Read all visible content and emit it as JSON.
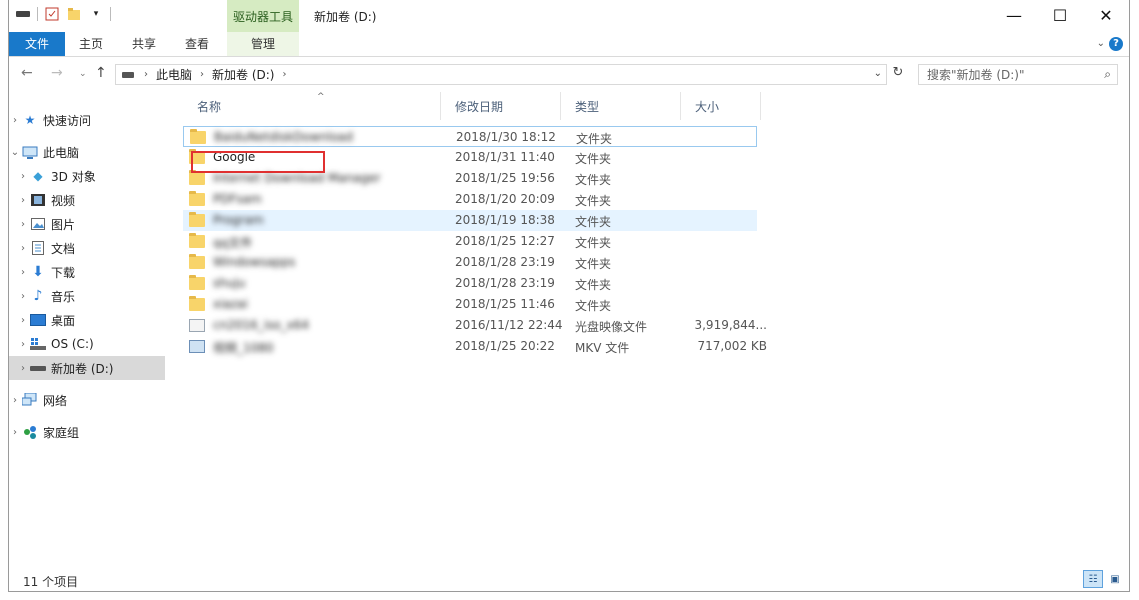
{
  "titlebar": {
    "context_tab_title": "驱动器工具",
    "window_title": "新加卷 (D:)",
    "minimize": "—",
    "maximize": "☐",
    "close": "✕"
  },
  "ribbon": {
    "tabs": {
      "file": "文件",
      "home": "主页",
      "share": "共享",
      "view": "查看",
      "manage": "管理"
    },
    "help": "?"
  },
  "address": {
    "crumbs": [
      "此电脑",
      "新加卷 (D:)"
    ],
    "separator": "›",
    "search_placeholder": "搜索\"新加卷 (D:)\""
  },
  "navpane": {
    "quick_access": "快速访问",
    "this_pc": "此电脑",
    "objects3d": "3D 对象",
    "videos": "视频",
    "pictures": "图片",
    "documents": "文档",
    "downloads": "下载",
    "music": "音乐",
    "desktop": "桌面",
    "os_c": "OS (C:)",
    "new_volume_d": "新加卷 (D:)",
    "network": "网络",
    "homegroup": "家庭组"
  },
  "columns": {
    "name": "名称",
    "date": "修改日期",
    "type": "类型",
    "size": "大小"
  },
  "files": [
    {
      "name": "BaiduNetdiskDownload",
      "date": "2018/1/30 18:12",
      "type": "文件夹",
      "size": "",
      "icon": "folder",
      "blurred": true
    },
    {
      "name": "Google",
      "date": "2018/1/31 11:40",
      "type": "文件夹",
      "size": "",
      "icon": "folder",
      "blurred": false
    },
    {
      "name": "Internet Download Manager",
      "date": "2018/1/25 19:56",
      "type": "文件夹",
      "size": "",
      "icon": "folder",
      "blurred": true
    },
    {
      "name": "PDFsam",
      "date": "2018/1/20 20:09",
      "type": "文件夹",
      "size": "",
      "icon": "folder",
      "blurred": true
    },
    {
      "name": "Program",
      "date": "2018/1/19 18:38",
      "type": "文件夹",
      "size": "",
      "icon": "folder",
      "blurred": true
    },
    {
      "name": "qq文件",
      "date": "2018/1/25 12:27",
      "type": "文件夹",
      "size": "",
      "icon": "folder",
      "blurred": true
    },
    {
      "name": "Windowsapps",
      "date": "2018/1/28 23:19",
      "type": "文件夹",
      "size": "",
      "icon": "folder",
      "blurred": true
    },
    {
      "name": "shuju",
      "date": "2018/1/28 23:19",
      "type": "文件夹",
      "size": "",
      "icon": "folder",
      "blurred": true
    },
    {
      "name": "xiazai",
      "date": "2018/1/25 11:46",
      "type": "文件夹",
      "size": "",
      "icon": "folder",
      "blurred": true
    },
    {
      "name": "cn2016_iso_x64",
      "date": "2016/11/12 22:44",
      "type": "光盘映像文件",
      "size": "3,919,844...",
      "icon": "doc",
      "blurred": true
    },
    {
      "name": "视频_1080",
      "date": "2018/1/25 20:22",
      "type": "MKV 文件",
      "size": "717,002 KB",
      "icon": "vid",
      "blurred": true
    }
  ],
  "status": {
    "item_count": "11 个项目"
  }
}
